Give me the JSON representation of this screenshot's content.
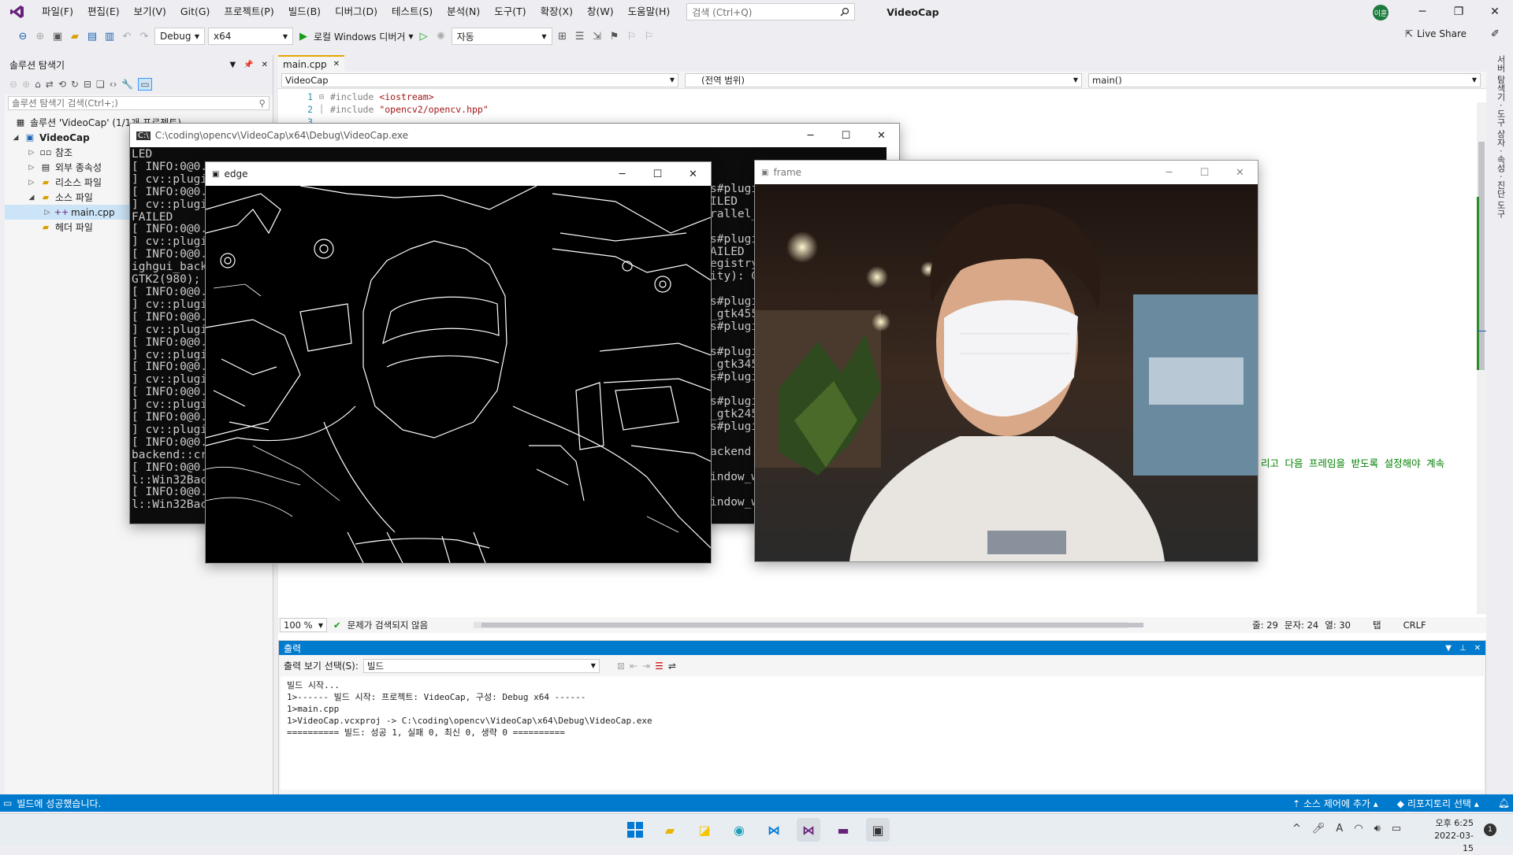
{
  "menu": {
    "items": [
      "파일(F)",
      "편집(E)",
      "보기(V)",
      "Git(G)",
      "프로젝트(P)",
      "빌드(B)",
      "디버그(D)",
      "테스트(S)",
      "분석(N)",
      "도구(T)",
      "확장(X)",
      "창(W)",
      "도움말(H)"
    ],
    "search_placeholder": "검색 (Ctrl+Q)",
    "solution_title": "VideoCap",
    "user_initials": "이훈"
  },
  "toolbar": {
    "config": "Debug",
    "platform": "x64",
    "run_label": "로컬 Windows 디버거",
    "auto": "자동",
    "live_share": "Live Share"
  },
  "solution_explorer": {
    "title": "솔루션 탐색기",
    "search_placeholder": "솔루션 탐색기 검색(Ctrl+;)",
    "solution": "솔루션 'VideoCap' (1/1개 프로젝트)",
    "project": "VideoCap",
    "items": [
      "참조",
      "외부 종속성",
      "리소스 파일",
      "소스 파일"
    ],
    "source_file": "main.cpp",
    "header_folder": "헤더 파일"
  },
  "editor": {
    "tab": "main.cpp",
    "nav_project": "VideoCap",
    "nav_scope": "(전역 범위)",
    "nav_func": "main()",
    "lines": [
      {
        "n": "1",
        "pre": "#include ",
        "str": "<iostream>"
      },
      {
        "n": "2",
        "pre": "#include ",
        "str": "\"opencv2/opencv.hpp\""
      },
      {
        "n": "3",
        "pre": "",
        "str": ""
      }
    ],
    "comment_fragment": "리고 다음 프레임을 받도록 설정해야 계속",
    "zoom": "100 %",
    "issues": "문제가 검색되지 않음",
    "line": "줄: 29",
    "char": "문자: 24",
    "col": "열: 30",
    "tab_mode": "탭",
    "eol": "CRLF"
  },
  "output": {
    "title": "출력",
    "source_label": "출력 보기 선택(S):",
    "source_value": "빌드",
    "lines": [
      "빌드 시작...",
      "1>------ 빌드 시작: 프로젝트: VideoCap, 구성: Debug x64 ------",
      "1>main.cpp",
      "1>VideoCap.vcxproj -> C:\\coding\\opencv\\VideoCap\\x64\\Debug\\VideoCap.exe",
      "========== 빌드: 성공 1, 실패 0, 최신 0, 생략 0 =========="
    ]
  },
  "statusbar": {
    "message": "빌드에 성공했습니다.",
    "source_control": "소스 제어에 추가",
    "repo": "리포지토리 선택"
  },
  "console": {
    "title": "C:\\coding\\opencv\\VideoCap\\x64\\Debug\\VideoCap.exe",
    "left_lines": [
      "LED",
      "[ INFO:0@0.4",
      "] cv::plugin",
      "[ INFO:0@0.4",
      "] cv::plugin",
      "FAILED",
      "[ INFO:0@0.4",
      "] cv::plugin",
      "[ INFO:0@0.4",
      "ighgui_backe",
      "GTK2(980); W",
      "[ INFO:0@0.4",
      "] cv::plugin",
      "[ INFO:0@0.5",
      "] cv::plugin",
      "[ INFO:0@0.5",
      "] cv::plugin",
      "[ INFO:0@0.5",
      "] cv::plugin",
      "[ INFO:0@0.5",
      "] cv::plugin",
      "[ INFO:0@0.5",
      "] cv::plugin",
      "[ INFO:0@0.5",
      "backend::cre",
      "[ INFO:0@0.5",
      "l::Win32Back",
      "[ INFO:0@0.5",
      "l::Win32Back"
    ],
    "right_lines": [
      "s#plugi",
      "ILED",
      "rallel_",
      "",
      "s#plugi",
      "AILED",
      "egistry",
      "ity): G",
      "",
      "s#plugi",
      "_gtk455",
      "s#plugi",
      "",
      "s#plugi",
      "_gtk345",
      "s#plugi",
      "",
      "s#plugi",
      "_gtk245",
      "s#plugi",
      "",
      "ackend.",
      "",
      "indow_w",
      "",
      "indow_w"
    ]
  },
  "edge_window": {
    "title": "edge"
  },
  "frame_window": {
    "title": "frame"
  },
  "taskbar": {
    "time": "오후 6:25",
    "date": "2022-03-15",
    "notifications": "1"
  }
}
